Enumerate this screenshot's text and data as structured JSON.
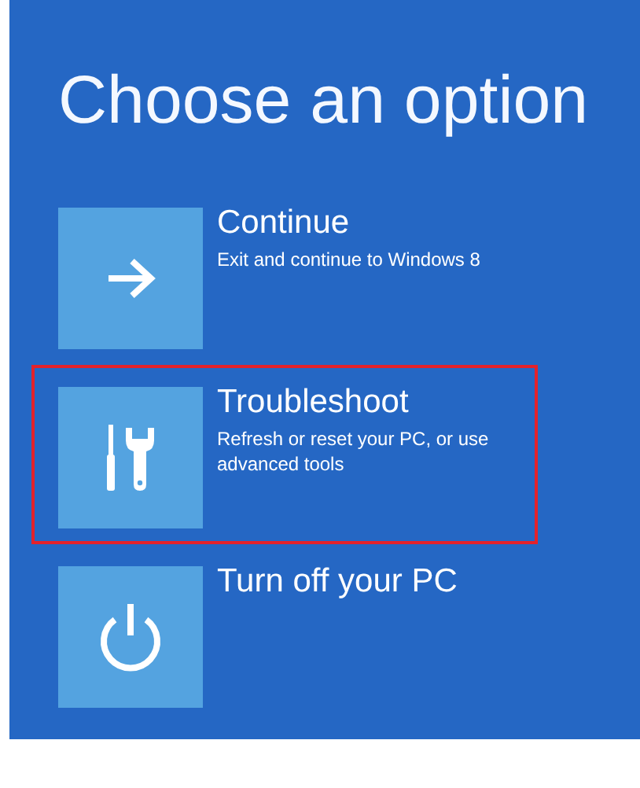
{
  "title": "Choose an option",
  "options": [
    {
      "kind": "arrow",
      "label": "Continue",
      "description": "Exit and continue to Windows 8",
      "selected": false
    },
    {
      "kind": "tools",
      "label": "Troubleshoot",
      "description": "Refresh or reset your PC, or use advanced tools",
      "selected": true
    },
    {
      "kind": "power",
      "label": "Turn off your PC",
      "selected": false
    }
  ]
}
